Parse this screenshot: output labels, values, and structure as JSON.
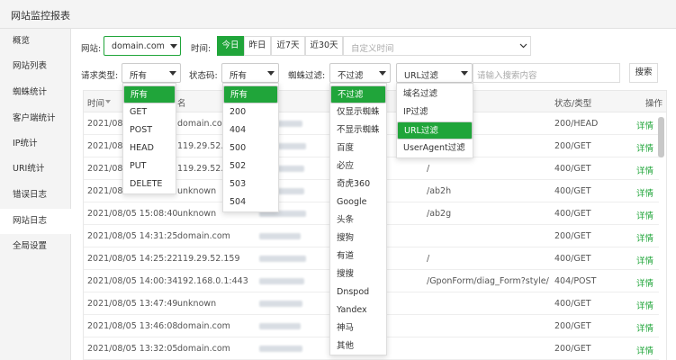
{
  "window": {
    "title": "网站监控报表"
  },
  "sidebar": {
    "items": [
      {
        "label": "概览",
        "active": false
      },
      {
        "label": "网站列表",
        "active": false
      },
      {
        "label": "蜘蛛统计",
        "active": false
      },
      {
        "label": "客户端统计",
        "active": false
      },
      {
        "label": "IP统计",
        "active": false
      },
      {
        "label": "URI统计",
        "active": false
      },
      {
        "label": "错误日志",
        "active": false
      },
      {
        "label": "网站日志",
        "active": true
      },
      {
        "label": "全局设置",
        "active": false
      }
    ]
  },
  "filters": {
    "site_label": "网站:",
    "site_value": "domain.com",
    "time_label": "时间:",
    "time_buttons": [
      {
        "label": "今日",
        "active": true
      },
      {
        "label": "昨日",
        "active": false
      },
      {
        "label": "近7天",
        "active": false
      },
      {
        "label": "近30天",
        "active": false
      }
    ],
    "custom_time_placeholder": "自定义时间",
    "method_label": "请求类型:",
    "method_value": "所有",
    "status_label": "状态码:",
    "status_value": "所有",
    "spider_label": "蜘蛛过滤:",
    "spider_value": "不过滤",
    "url_filter_value": "URL过滤",
    "search_placeholder": "请输入搜索内容",
    "search_button": "搜索"
  },
  "table": {
    "headers": {
      "time": "时间",
      "domain": "名",
      "status": "状态/类型",
      "action": "操作"
    },
    "rows": [
      {
        "time": "2021/08/",
        "domain": "domain.com",
        "uri": "",
        "status": "200/HEAD",
        "action": "详情"
      },
      {
        "time": "2021/08/",
        "domain": "119.29.52.159",
        "uri": "",
        "status": "200/GET",
        "action": "详情"
      },
      {
        "time": "2021/08/",
        "domain": "119.29.52.159",
        "uri": "/",
        "status": "400/GET",
        "action": "详情"
      },
      {
        "time": "2021/08/",
        "domain": "unknown",
        "uri": "/ab2h",
        "status": "400/GET",
        "action": "详情"
      },
      {
        "time": "2021/08/05 15:08:40",
        "domain": "unknown",
        "uri": "/ab2g",
        "status": "400/GET",
        "action": "详情"
      },
      {
        "time": "2021/08/05 14:31:25",
        "domain": "domain.com",
        "uri": "",
        "status": "200/GET",
        "action": "详情"
      },
      {
        "time": "2021/08/05 14:25:22",
        "domain": "119.29.52.159",
        "uri": "/",
        "status": "400/GET",
        "action": "详情"
      },
      {
        "time": "2021/08/05 14:00:34",
        "domain": "192.168.0.1:443",
        "uri": "/GponForm/diag_Form?style/",
        "status": "404/POST",
        "action": "详情"
      },
      {
        "time": "2021/08/05 13:47:49",
        "domain": "unknown",
        "uri": "",
        "status": "400/GET",
        "action": "详情"
      },
      {
        "time": "2021/08/05 13:46:08",
        "domain": "domain.com",
        "uri": "",
        "status": "200/GET",
        "action": "详情"
      },
      {
        "time": "2021/08/05 13:32:05",
        "domain": "domain.com",
        "uri": "",
        "status": "200/GET",
        "action": "详情"
      }
    ]
  },
  "menus": {
    "method": [
      "所有",
      "GET",
      "POST",
      "HEAD",
      "PUT",
      "DELETE"
    ],
    "status": [
      "所有",
      "200",
      "404",
      "500",
      "502",
      "503",
      "504"
    ],
    "spider": [
      "不过滤",
      "仅显示蜘蛛",
      "不显示蜘蛛",
      "百度",
      "必应",
      "奇虎360",
      "Google",
      "头条",
      "搜狗",
      "有道",
      "搜搜",
      "Dnspod",
      "Yandex",
      "神马",
      "其他"
    ],
    "url_filter": [
      "域名过滤",
      "IP过滤",
      "URL过滤",
      "UserAgent过滤"
    ]
  },
  "colors": {
    "accent": "#20a53a",
    "sidebar_bg": "#f4f4f4"
  }
}
